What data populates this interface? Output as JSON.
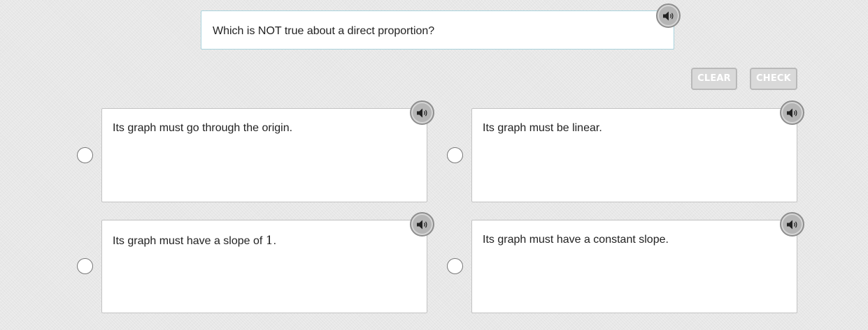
{
  "question": {
    "text": "Which is NOT true about a direct proportion?",
    "audio_icon": "speaker-icon"
  },
  "actions": {
    "clear_label": "CLEAR",
    "check_label": "CHECK",
    "enabled": false
  },
  "options": [
    {
      "text_before": "Its graph must go through the origin.",
      "math": "",
      "text_after": ""
    },
    {
      "text_before": "Its graph must be linear.",
      "math": "",
      "text_after": ""
    },
    {
      "text_before": "Its graph must have a slope of ",
      "math": "1",
      "text_after": "."
    },
    {
      "text_before": "Its graph must have a constant slope.",
      "math": "",
      "text_after": ""
    }
  ],
  "colors": {
    "background": "#e7e7e7",
    "question_border": "#a9d2dc",
    "audio_button": "#b5b5b5",
    "disabled_button": "#d9d9d9"
  }
}
